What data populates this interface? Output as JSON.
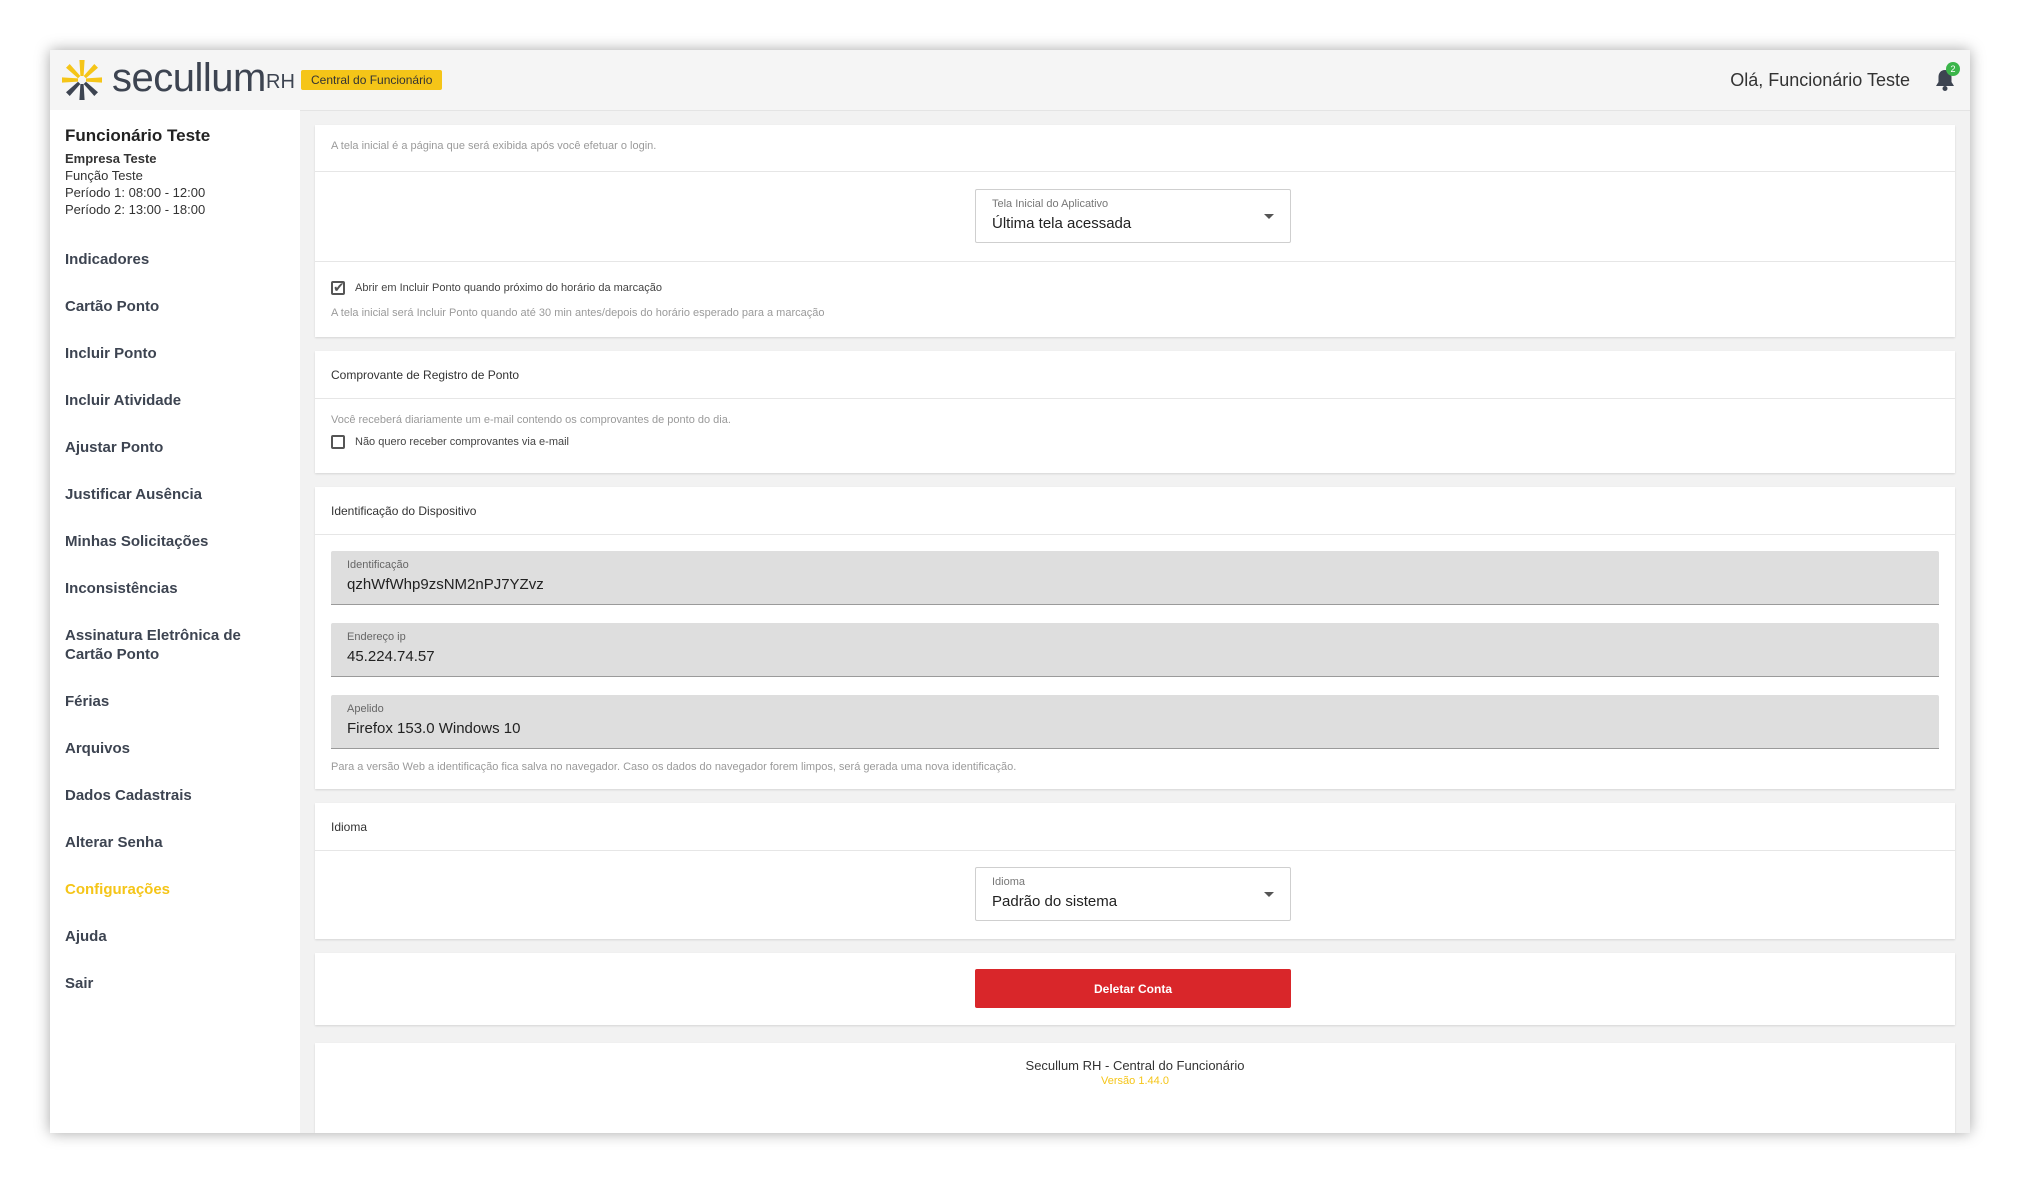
{
  "header": {
    "logo_text": "secullum",
    "logo_rh": "RH",
    "portal_badge": "Central do Funcionário",
    "greeting": "Olá, Funcionário Teste",
    "notification_count": "2",
    "colors": {
      "accent": "#f5c518",
      "danger": "#d9262a",
      "notification": "#3bb54a"
    }
  },
  "user": {
    "name": "Funcionário Teste",
    "company": "Empresa Teste",
    "role": "Função Teste",
    "period1": "Período 1: 08:00 - 12:00",
    "period2": "Período 2: 13:00 - 18:00"
  },
  "sidebar": {
    "items": [
      {
        "label": "Indicadores"
      },
      {
        "label": "Cartão Ponto"
      },
      {
        "label": "Incluir Ponto"
      },
      {
        "label": "Incluir Atividade"
      },
      {
        "label": "Ajustar Ponto"
      },
      {
        "label": "Justificar Ausência"
      },
      {
        "label": "Minhas Solicitações"
      },
      {
        "label": "Inconsistências"
      },
      {
        "label": "Assinatura Eletrônica de Cartão Ponto"
      },
      {
        "label": "Férias"
      },
      {
        "label": "Arquivos"
      },
      {
        "label": "Dados Cadastrais"
      },
      {
        "label": "Alterar Senha"
      },
      {
        "label": "Configurações",
        "active": true
      },
      {
        "label": "Ajuda"
      },
      {
        "label": "Sair"
      }
    ]
  },
  "home_screen": {
    "description": "A tela inicial é a página que será exibida após você efetuar o login.",
    "select_label": "Tela Inicial do Aplicativo",
    "select_value": "Última tela acessada",
    "checkbox_label": "Abrir em Incluir Ponto quando próximo do horário da marcação",
    "checkbox_checked": true,
    "hint": "A tela inicial será Incluir Ponto quando até 30 min antes/depois do horário esperado para a marcação"
  },
  "receipt": {
    "title": "Comprovante de Registro de Ponto",
    "description": "Você receberá diariamente um e-mail contendo os comprovantes de ponto do dia.",
    "checkbox_label": "Não quero receber comprovantes via e-mail",
    "checkbox_checked": false
  },
  "device": {
    "title": "Identificação do Dispositivo",
    "id_label": "Identificação",
    "id_value": "qzhWfWhp9zsNM2nPJ7YZvz",
    "ip_label": "Endereço ip",
    "ip_value": "45.224.74.57",
    "nickname_label": "Apelido",
    "nickname_value": "Firefox 153.0 Windows 10",
    "hint": "Para a versão Web a identificação fica salva no navegador. Caso os dados do navegador forem limpos, será gerada uma nova identificação."
  },
  "language": {
    "title": "Idioma",
    "select_label": "Idioma",
    "select_value": "Padrão do sistema"
  },
  "account": {
    "delete_label": "Deletar Conta"
  },
  "footer": {
    "title": "Secullum RH - Central do Funcionário",
    "version": "Versão 1.44.0"
  }
}
